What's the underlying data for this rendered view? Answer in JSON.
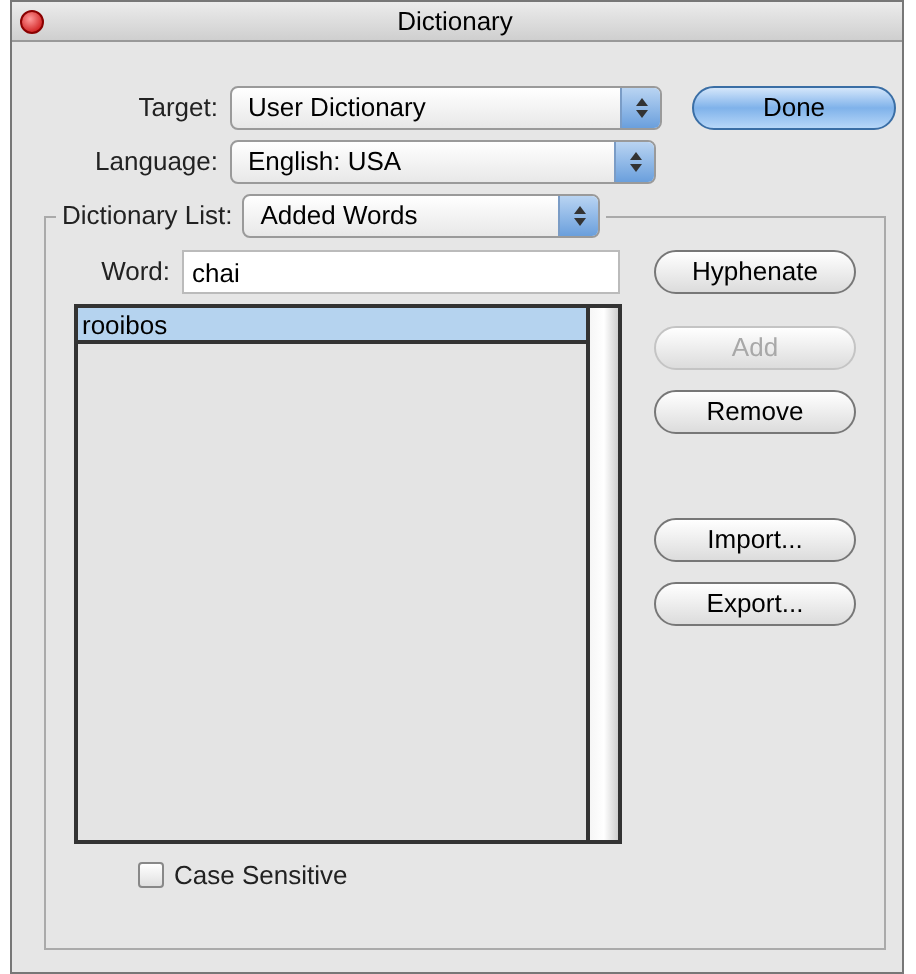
{
  "window": {
    "title": "Dictionary"
  },
  "target": {
    "label": "Target:",
    "value": "User Dictionary"
  },
  "language": {
    "label": "Language:",
    "value": "English: USA"
  },
  "done_button": {
    "label": "Done",
    "default": true
  },
  "dictionary_list": {
    "label": "Dictionary List:",
    "value": "Added Words"
  },
  "word": {
    "label": "Word:",
    "value": "chai"
  },
  "words": [
    {
      "text": "rooibos",
      "selected": true
    }
  ],
  "buttons": [
    {
      "label": "Hyphenate",
      "disabled": false
    },
    {
      "label": "Add",
      "disabled": true
    },
    {
      "label": "Remove",
      "disabled": false
    },
    {
      "label": "Import...",
      "disabled": false
    },
    {
      "label": "Export...",
      "disabled": false
    }
  ],
  "case_sensitive": {
    "label": "Case Sensitive",
    "checked": false
  }
}
